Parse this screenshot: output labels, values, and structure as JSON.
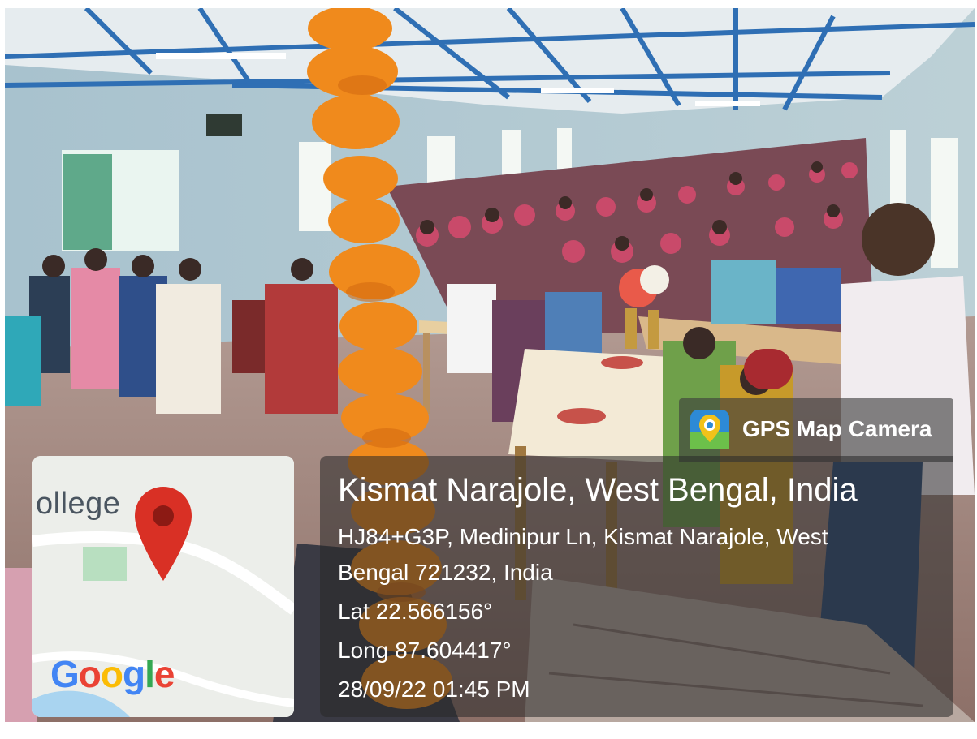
{
  "badge": {
    "label": "GPS Map Camera",
    "icon": "gps-camera-icon"
  },
  "location": {
    "title": "Kismat Narajole, West Bengal, India",
    "address_line1": "HJ84+G3P, Medinipur Ln, Kismat Narajole, West",
    "address_line2": "Bengal 721232, India",
    "lat": "Lat 22.566156°",
    "long": "Long 87.604417°",
    "datetime": "28/09/22 01:45 PM"
  },
  "map": {
    "place_label": "ollege",
    "brand": [
      "G",
      "o",
      "o",
      "g",
      "l",
      "e"
    ],
    "brand_colors": [
      "#4285F4",
      "#EA4335",
      "#FBBC05",
      "#4285F4",
      "#34A853",
      "#EA4335"
    ],
    "pin_color": "#D93025"
  },
  "photo": {
    "description_colors": {
      "wall": "#9fb8c4",
      "roof": "#3a74b5",
      "floor": "#a58a80",
      "garland": "#f08a1c"
    }
  }
}
